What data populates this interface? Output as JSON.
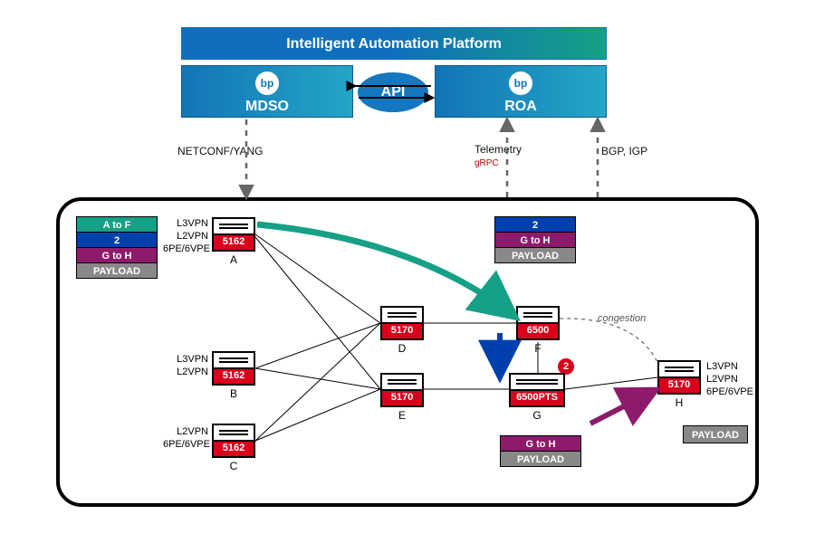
{
  "top": {
    "title": "Intelligent Automation Platform",
    "mdso": "MDSO",
    "roa": "ROA",
    "api": "API",
    "bp": "bp"
  },
  "connectors": {
    "netconf": "NETCONF/YANG",
    "telemetry": "Telemetry",
    "grpc": "gRPC",
    "bgp": "BGP, IGP",
    "congestion": "congestion"
  },
  "stacks": {
    "left": {
      "a": "A to F",
      "b": "2",
      "c": "G to H",
      "d": "PAYLOAD"
    },
    "topright": {
      "a": "2",
      "b": "G to H",
      "c": "PAYLOAD"
    },
    "mid": {
      "a": "G to H",
      "b": "PAYLOAD"
    }
  },
  "badge": "2",
  "payload_h": "PAYLOAD",
  "routers": {
    "A": {
      "model": "5162",
      "name": "A",
      "labels": [
        "L3VPN",
        "L2VPN",
        "6PE/6VPE"
      ]
    },
    "B": {
      "model": "5162",
      "name": "B",
      "labels": [
        "L3VPN",
        "L2VPN"
      ]
    },
    "C": {
      "model": "5162",
      "name": "C",
      "labels": [
        "L2VPN",
        "6PE/6VPE"
      ]
    },
    "D": {
      "model": "5170",
      "name": "D"
    },
    "E": {
      "model": "5170",
      "name": "E"
    },
    "F": {
      "model": "6500",
      "name": "F"
    },
    "G": {
      "model": "6500PTS",
      "name": "G"
    },
    "H": {
      "model": "5170",
      "name": "H",
      "labels": [
        "L3VPN",
        "L2VPN",
        "6PE/6VPE"
      ]
    }
  }
}
